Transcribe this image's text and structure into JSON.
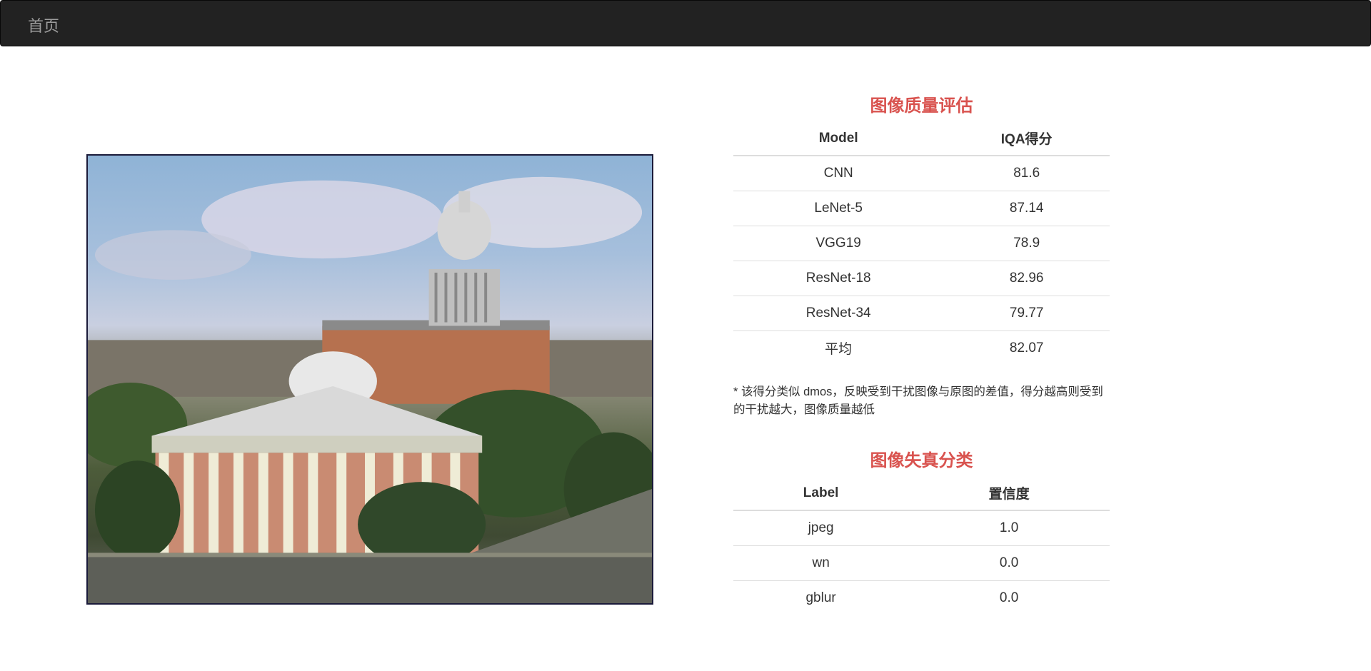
{
  "navbar": {
    "brand": "首页"
  },
  "iqa": {
    "title": "图像质量评估",
    "headers": [
      "Model",
      "IQA得分"
    ],
    "rows": [
      [
        "CNN",
        "81.6"
      ],
      [
        "LeNet-5",
        "87.14"
      ],
      [
        "VGG19",
        "78.9"
      ],
      [
        "ResNet-18",
        "82.96"
      ],
      [
        "ResNet-34",
        "79.77"
      ],
      [
        "平均",
        "82.07"
      ]
    ],
    "note": "* 该得分类似 dmos，反映受到干扰图像与原图的差值，得分越高则受到的干扰越大，图像质量越低"
  },
  "distortion": {
    "title": "图像失真分类",
    "headers": [
      "Label",
      "置信度"
    ],
    "rows": [
      [
        "jpeg",
        "1.0"
      ],
      [
        "wn",
        "0.0"
      ],
      [
        "gblur",
        "0.0"
      ]
    ]
  },
  "colors": {
    "navbar": "#222222",
    "brand_text": "#9d9d9d",
    "section_title": "#d9534f"
  }
}
